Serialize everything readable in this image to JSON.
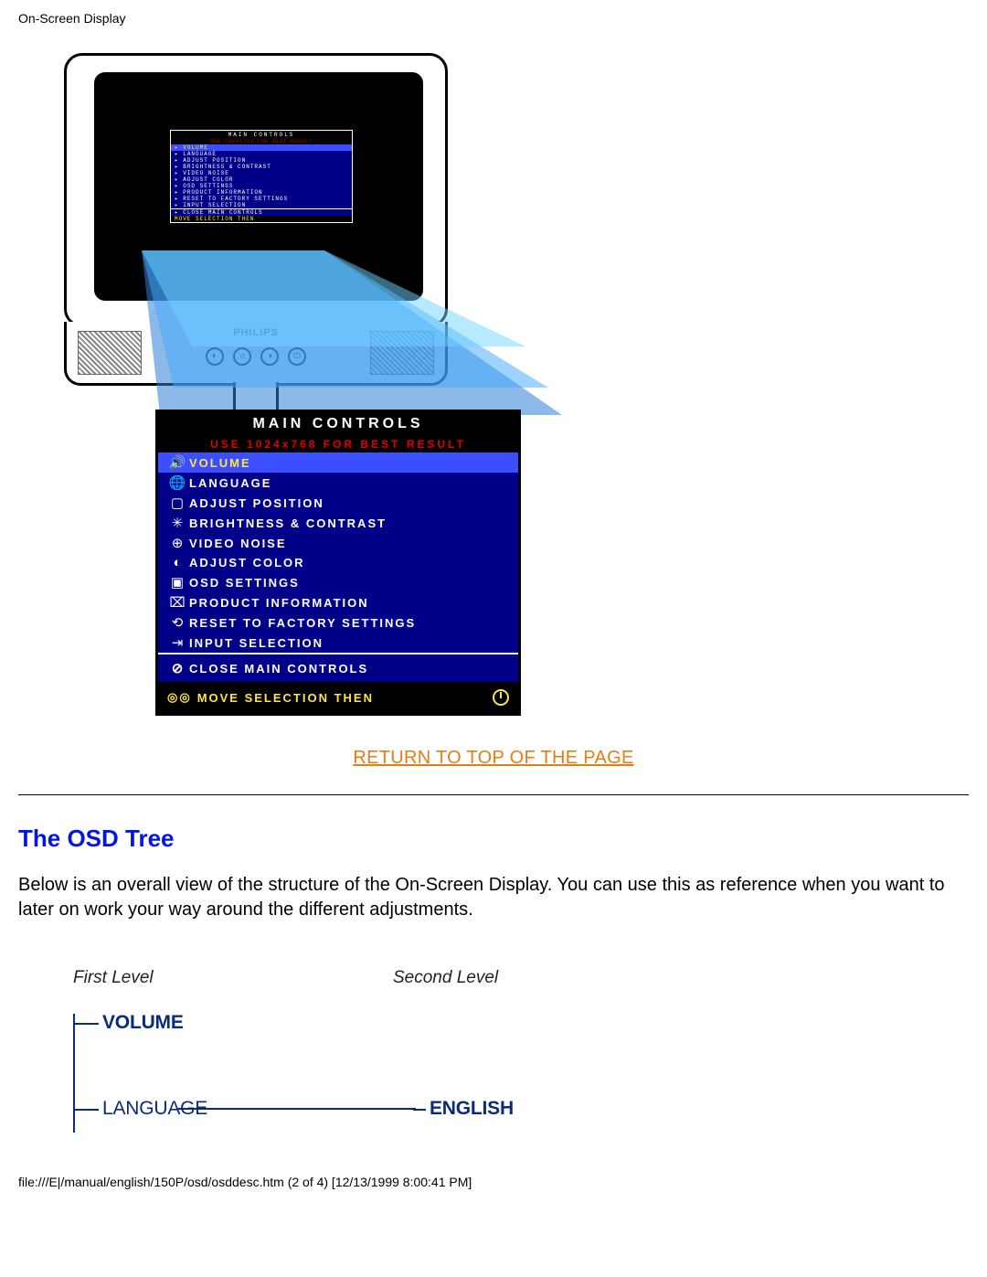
{
  "header": "On-Screen Display",
  "monitor_brand": "PHILIPS",
  "osd": {
    "title": "MAIN CONTROLS",
    "hint": "USE 1024x768 FOR BEST RESULT",
    "items": [
      {
        "icon": "🔊",
        "label": "VOLUME",
        "selected": true
      },
      {
        "icon": "🌐",
        "label": "LANGUAGE"
      },
      {
        "icon": "▢",
        "label": "ADJUST POSITION"
      },
      {
        "icon": "✳",
        "label": "BRIGHTNESS & CONTRAST"
      },
      {
        "icon": "⊕",
        "label": "VIDEO NOISE"
      },
      {
        "icon": "◐",
        "label": "ADJUST COLOR"
      },
      {
        "icon": "▣",
        "label": "OSD SETTINGS"
      },
      {
        "icon": "⌧",
        "label": "PRODUCT INFORMATION"
      },
      {
        "icon": "⟲",
        "label": "RESET TO FACTORY SETTINGS"
      },
      {
        "icon": "⇥",
        "label": "INPUT SELECTION"
      }
    ],
    "close": {
      "icon": "⊘",
      "label": "CLOSE MAIN CONTROLS"
    },
    "move_hint": "MOVE SELECTION THEN"
  },
  "return_link": "RETURN TO TOP OF THE PAGE",
  "section_title": "The OSD Tree",
  "body_text": "Below is an overall view of the structure of the On-Screen Display. You can use this as reference when you want to later on work your way around the different adjustments.",
  "tree": {
    "first_level_label": "First Level",
    "second_level_label": "Second Level",
    "volume": "VOLUME",
    "language": "LANGUAGE",
    "english": "ENGLISH"
  },
  "footer": "file:///E|/manual/english/150P/osd/osddesc.htm (2 of 4) [12/13/1999 8:00:41 PM]"
}
